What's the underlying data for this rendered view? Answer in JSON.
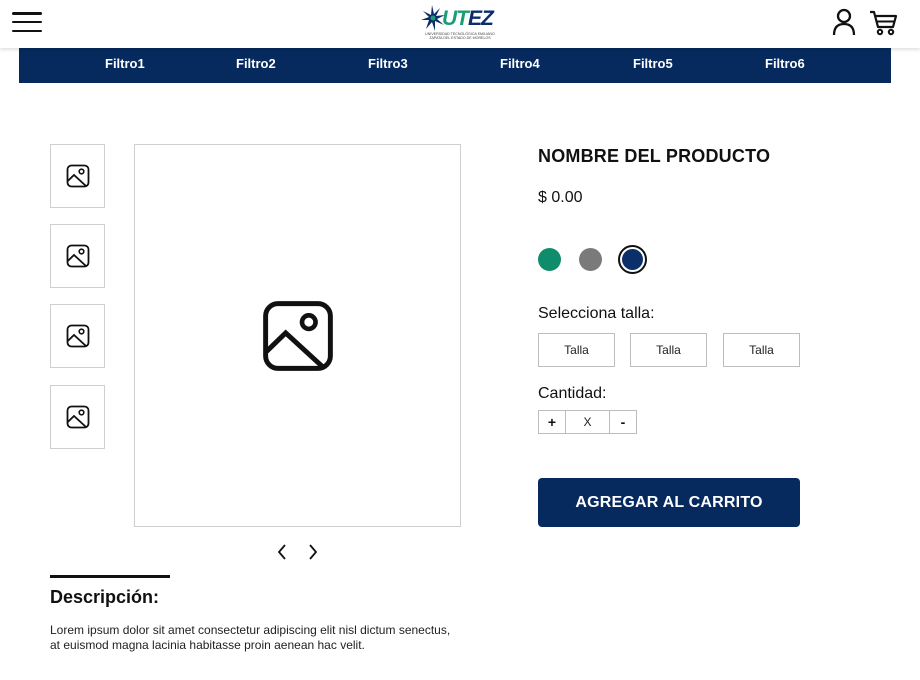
{
  "header": {
    "logo": {
      "wordmark_a": "UT",
      "wordmark_b": "EZ",
      "subtitle": "UNIVERSIDAD TECNOLÓGICA EMILIANO ZAPATA DEL ESTADO DE MORELOS",
      "icon": "logo-star-icon"
    },
    "menu_icon": "hamburger-icon",
    "user_icon": "user-icon",
    "cart_icon": "cart-icon"
  },
  "filters": [
    "Filtro1",
    "Filtro2",
    "Filtro3",
    "Filtro4",
    "Filtro5",
    "Filtro6"
  ],
  "gallery": {
    "thumbnail_icon": "image-placeholder-icon",
    "thumbnail_count": 4,
    "prev_icon": "chevron-left-icon",
    "next_icon": "chevron-right-icon"
  },
  "product": {
    "name": "NOMBRE DEL PRODUCTO",
    "price": "$ 0.00",
    "colors": [
      {
        "hex": "#0f8c6c",
        "selected": false
      },
      {
        "hex": "#7a7a7a",
        "selected": false
      },
      {
        "hex": "#0b2f6b",
        "selected": true
      }
    ],
    "size_label": "Selecciona talla:",
    "sizes": [
      "Talla",
      "Talla",
      "Talla"
    ],
    "quantity_label": "Cantidad:",
    "quantity_plus": "+",
    "quantity_value": "X",
    "quantity_minus": "-",
    "add_to_cart": "AGREGAR AL CARRITO"
  },
  "description": {
    "title": "Descripción:",
    "text": "Lorem ipsum dolor sit amet consectetur adipiscing elit nisl dictum senectus, at euismod magna lacinia habitasse proin aenean hac velit."
  },
  "colors": {
    "brand_navy": "#062a5e",
    "brand_green": "#1a9c74"
  }
}
